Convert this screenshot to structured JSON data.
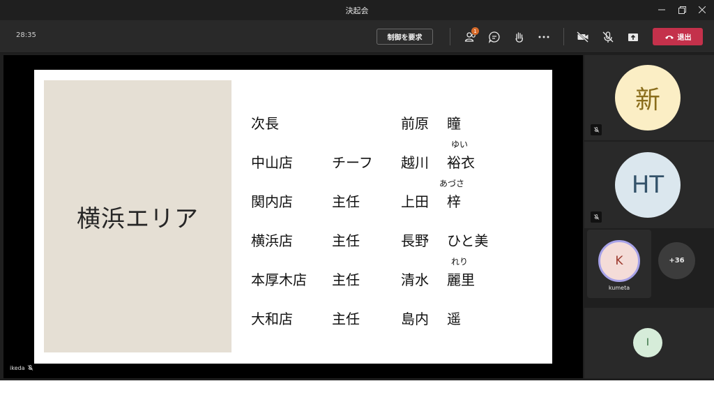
{
  "window": {
    "title": "決起会"
  },
  "toolbar": {
    "timer": "28:35",
    "request_control_label": "制御を要求",
    "participants_badge": "1",
    "leave_label": "退出"
  },
  "slide": {
    "area_title": "横浜エリア",
    "rows": [
      {
        "store": "次長",
        "role": "",
        "surname": "前原",
        "given": "瞳",
        "ruby": ""
      },
      {
        "store": "中山店",
        "role": "チーフ",
        "surname": "越川",
        "given": "裕衣",
        "ruby": "ゆい"
      },
      {
        "store": "関内店",
        "role": "主任",
        "surname": "上田",
        "given": "梓",
        "ruby": "あづさ"
      },
      {
        "store": "横浜店",
        "role": "主任",
        "surname": "長野",
        "given": "ひと美",
        "ruby": ""
      },
      {
        "store": "本厚木店",
        "role": "主任",
        "surname": "清水",
        "given": "麗里",
        "ruby": "れり"
      },
      {
        "store": "大和店",
        "role": "主任",
        "surname": "島内",
        "given": "遥",
        "ruby": ""
      }
    ]
  },
  "presenter": {
    "name": "ikeda"
  },
  "gallery": {
    "p1_initial": "新",
    "p2_initial": "HT",
    "p3_initial": "K",
    "p3_name": "kumeta",
    "overflow": "+36",
    "p4_initial": "I"
  },
  "colors": {
    "leave": "#c4314b",
    "badge": "#d66a2a",
    "slide_panel": "#e5dfd4"
  }
}
